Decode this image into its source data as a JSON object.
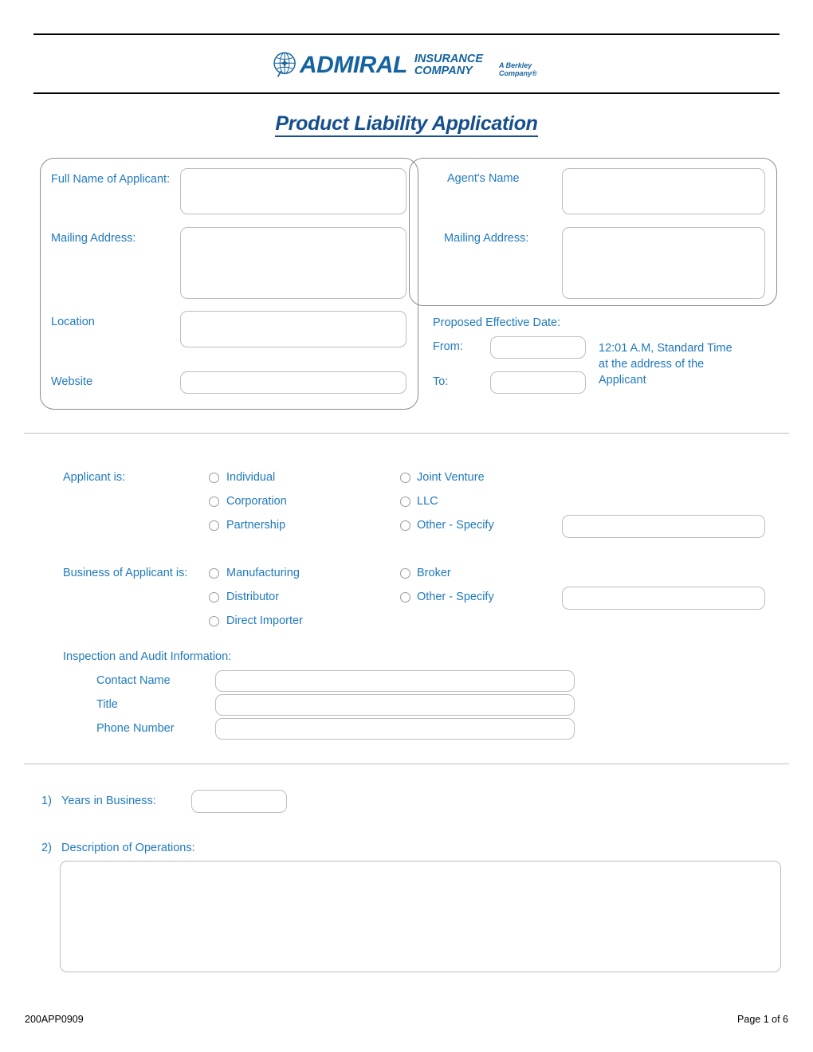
{
  "header": {
    "logo": {
      "globe_icon": "globe-icon",
      "brand": "ADMIRAL",
      "line1": "INSURANCE",
      "line2": "COMPANY",
      "tagline": "A Berkley Company®"
    },
    "title": "Product Liability Application"
  },
  "applicant_panel": {
    "full_name_label": "Full Name of Applicant:",
    "full_name_value": "",
    "mailing_address_label": "Mailing Address:",
    "mailing_address_value": "",
    "location_label": "Location",
    "location_value": "",
    "website_label": "Website",
    "website_value": ""
  },
  "agent_panel": {
    "agent_name_label": "Agent's Name",
    "agent_name_value": "",
    "mailing_address_label": "Mailing Address:",
    "mailing_address_value": ""
  },
  "effective_date": {
    "heading": "Proposed Effective Date:",
    "from_label": "From:",
    "from_value": "",
    "to_label": "To:",
    "to_value": "",
    "note_line1": "12:01 A.M, Standard Time",
    "note_line2": "at the address of the",
    "note_line3": "Applicant"
  },
  "applicant_is": {
    "label": "Applicant is:",
    "options_left": [
      "Individual",
      "Corporation",
      "Partnership"
    ],
    "options_right": [
      "Joint Venture",
      "LLC",
      "Other - Specify"
    ],
    "other_value": ""
  },
  "business_is": {
    "label": "Business of Applicant is:",
    "options_left": [
      "Manufacturing",
      "Distributor",
      "Direct Importer"
    ],
    "options_right": [
      "Broker",
      "Other - Specify"
    ],
    "other_value": ""
  },
  "inspection": {
    "heading": "Inspection and Audit Information:",
    "rows": [
      {
        "label": "Contact Name",
        "value": ""
      },
      {
        "label": "Title",
        "value": ""
      },
      {
        "label": "Phone Number",
        "value": ""
      }
    ]
  },
  "questions": {
    "q1_number": "1)",
    "q1_label": "Years in Business:",
    "q1_value": "",
    "q2_number": "2)",
    "q2_label": "Description of Operations:",
    "q2_value": ""
  },
  "footer": {
    "form_code": "200APP0909",
    "page_label": "Page 1 of 6"
  },
  "colors": {
    "label_blue": "#1F79BD",
    "title_blue": "#144E8C",
    "logo_blue": "#15639E",
    "field_border": "#BDBDBD",
    "panel_border": "#8C8C8C",
    "divider": "#BFBFBF"
  }
}
